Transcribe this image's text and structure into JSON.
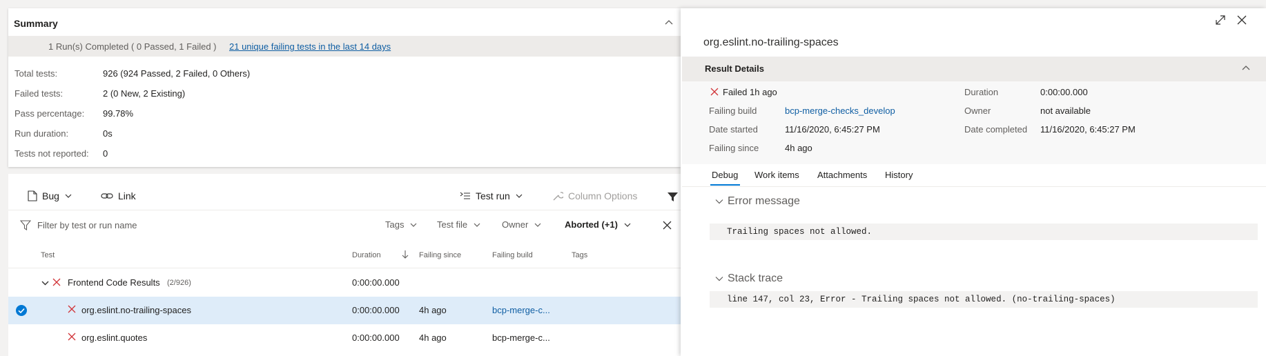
{
  "summary": {
    "title": "Summary",
    "banner_text": "1 Run(s) Completed ( 0 Passed, 1 Failed )",
    "banner_link": "21 unique failing tests in the last 14 days",
    "stats": [
      {
        "label": "Total tests:",
        "value": "926 (924 Passed, 2 Failed, 0 Others)"
      },
      {
        "label": "Failed tests:",
        "value": "2 (0 New, 2 Existing)"
      },
      {
        "label": "Pass percentage:",
        "value": "99.78%"
      },
      {
        "label": "Run duration:",
        "value": "0s"
      },
      {
        "label": "Tests not reported:",
        "value": "0"
      }
    ]
  },
  "toolbar": {
    "bug": "Bug",
    "link": "Link",
    "test_run": "Test run",
    "column_options": "Column Options"
  },
  "filter": {
    "placeholder": "Filter by test or run name",
    "tags": "Tags",
    "test_file": "Test file",
    "owner": "Owner",
    "outcome": "Aborted (+1)"
  },
  "columns": {
    "test": "Test",
    "duration": "Duration",
    "failing_since": "Failing since",
    "failing_build": "Failing build",
    "tags": "Tags"
  },
  "group": {
    "name": "Frontend Code Results",
    "count": "(2/926)",
    "duration": "0:00:00.000"
  },
  "rows": [
    {
      "test": "org.eslint.no-trailing-spaces",
      "duration": "0:00:00.000",
      "failing_since": "4h ago",
      "failing_build": "bcp-merge-c..."
    },
    {
      "test": "org.eslint.quotes",
      "duration": "0:00:00.000",
      "failing_since": "4h ago",
      "failing_build": "bcp-merge-c..."
    }
  ],
  "detail": {
    "title": "org.eslint.no-trailing-spaces",
    "section": "Result Details",
    "status": "Failed 1h ago",
    "failing_build_label": "Failing build",
    "failing_build_value": "bcp-merge-checks_develop",
    "date_started_label": "Date started",
    "date_started_value": "11/16/2020, 6:45:27 PM",
    "failing_since_label": "Failing since",
    "failing_since_value": "4h ago",
    "duration_label": "Duration",
    "duration_value": "0:00:00.000",
    "owner_label": "Owner",
    "owner_value": "not available",
    "date_completed_label": "Date completed",
    "date_completed_value": "11/16/2020, 6:45:27 PM",
    "tabs": [
      "Debug",
      "Work items",
      "Attachments",
      "History"
    ],
    "error_title": "Error message",
    "error_text": "Trailing spaces not allowed.",
    "stack_title": "Stack trace",
    "stack_text": "line 147, col 23, Error - Trailing spaces not allowed. (no-trailing-spaces)"
  },
  "colors": {
    "accent": "#0f5ea3",
    "fail_red": "#d13438",
    "selected_row": "#deecf9",
    "check_blue": "#0078d4"
  }
}
